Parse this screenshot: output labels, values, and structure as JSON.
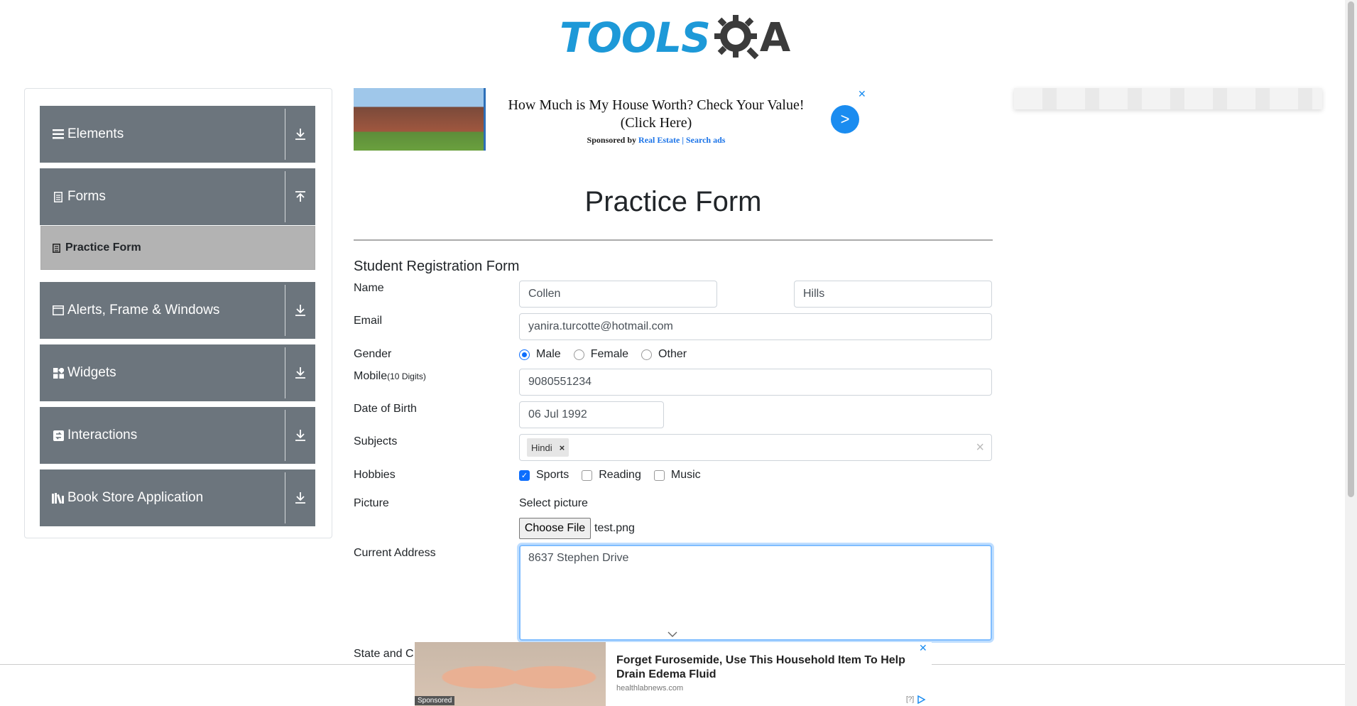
{
  "logo": {
    "text": "TOOLS",
    "q": "Q",
    "a": "A"
  },
  "sidebar": {
    "groups": [
      {
        "label": "Elements",
        "icon": "menu-icon"
      },
      {
        "label": "Forms",
        "icon": "document-icon"
      },
      {
        "label": "Alerts, Frame & Windows",
        "icon": "window-icon"
      },
      {
        "label": "Widgets",
        "icon": "widgets-icon"
      },
      {
        "label": "Interactions",
        "icon": "interactions-icon"
      },
      {
        "label": "Book Store Application",
        "icon": "books-icon"
      }
    ],
    "active_item": "Practice Form"
  },
  "top_ad": {
    "title": "How Much is My House Worth? Check Your Value! (Click Here)",
    "sponsor_prefix": "Sponsored by",
    "sponsor_links": "Real Estate | Search ads",
    "go": ">",
    "close": "✕"
  },
  "main": {
    "title": "Practice Form",
    "form_title": "Student Registration Form"
  },
  "form": {
    "name_label": "Name",
    "first_name": "Collen",
    "last_name": "Hills",
    "email_label": "Email",
    "email": "yanira.turcotte@hotmail.com",
    "gender_label": "Gender",
    "gender_options": [
      "Male",
      "Female",
      "Other"
    ],
    "mobile_label": "Mobile",
    "mobile_hint": "(10 Digits)",
    "mobile": "9080551234",
    "dob_label": "Date of Birth",
    "dob": "06 Jul 1992",
    "subjects_label": "Subjects",
    "subject_chip": "Hindi",
    "chip_remove": "×",
    "clear": "×",
    "hobbies_label": "Hobbies",
    "hobbies": [
      "Sports",
      "Reading",
      "Music"
    ],
    "picture_label": "Picture",
    "select_picture": "Select picture",
    "choose_file": "Choose File",
    "file_name": "test.png",
    "address_label": "Current Address",
    "address": "8637 Stephen Drive",
    "state_label": "State and C"
  },
  "bottom_ad": {
    "title": "Forget Furosemide, Use This Household Item To Help Drain Edema Fluid",
    "source": "healthlabnews.com",
    "sponsored": "Sponsored",
    "close": "✕",
    "info": "[?]"
  },
  "colors": {
    "sidebar": "#6c757d",
    "accent": "#0d6efd",
    "logo_blue": "#1d99d8"
  }
}
